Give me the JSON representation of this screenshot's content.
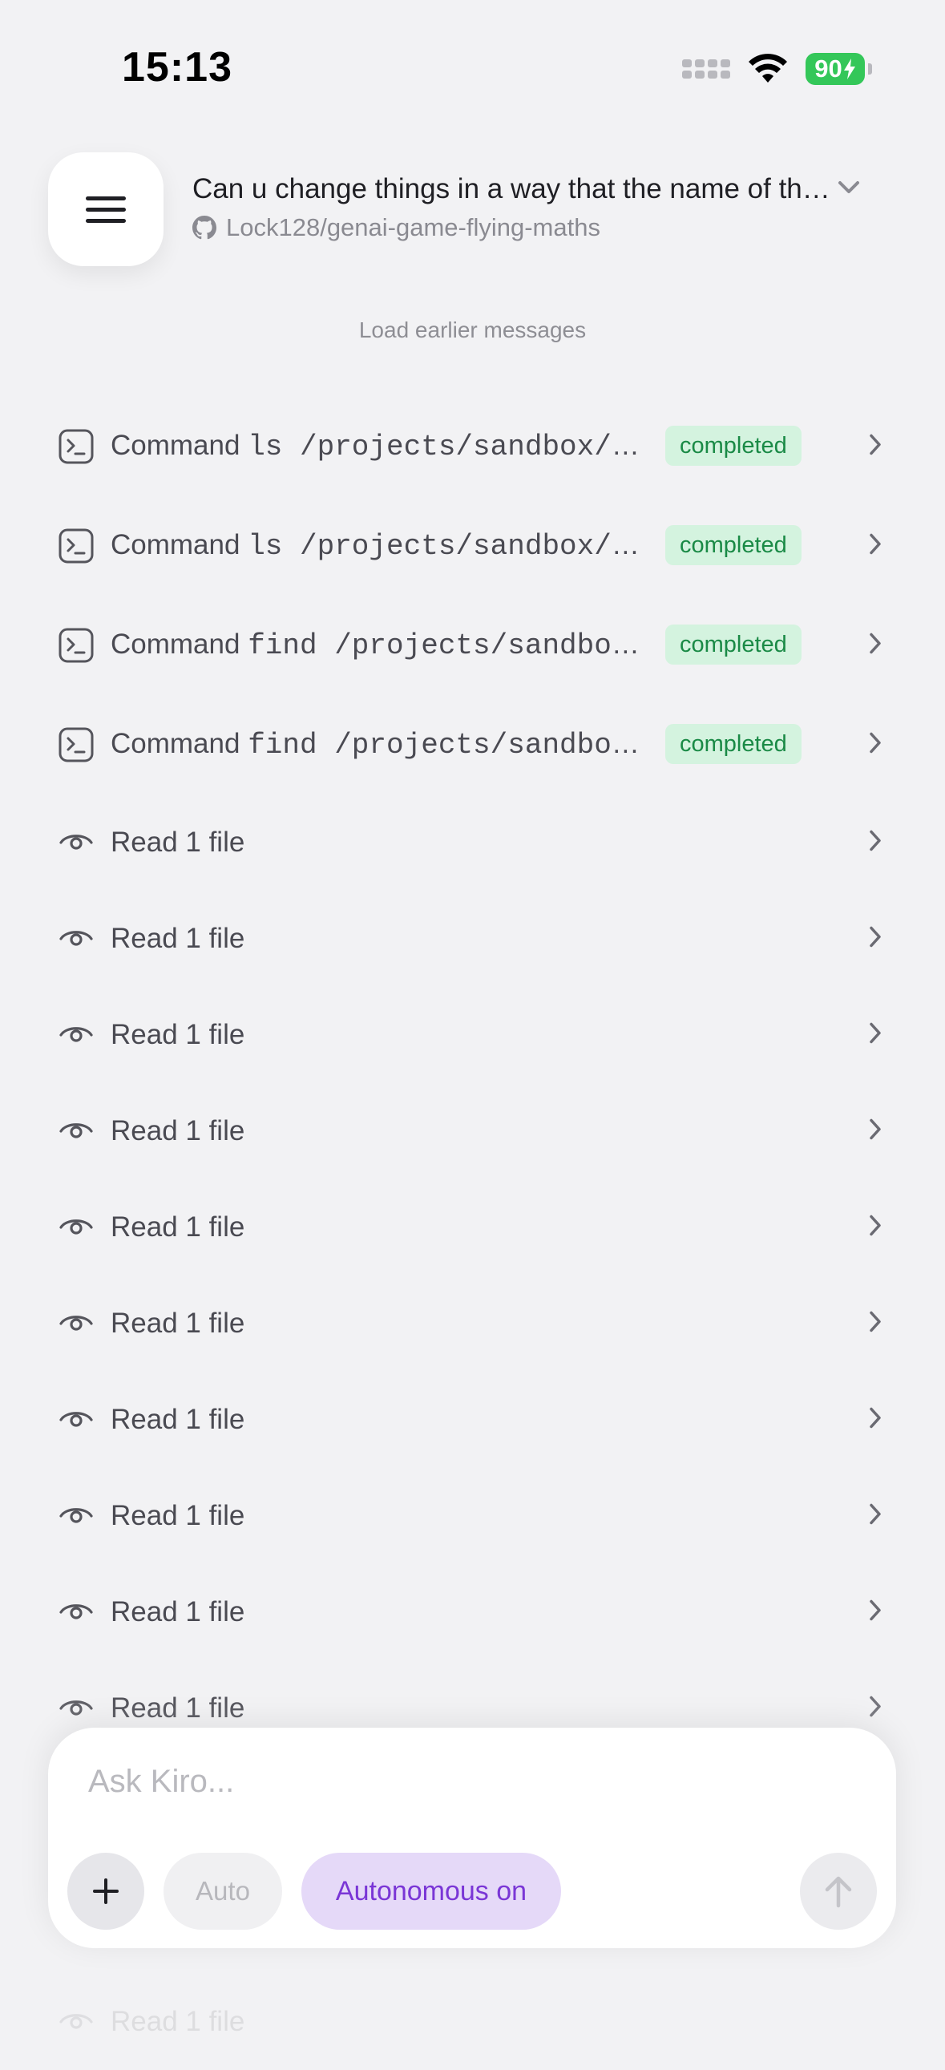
{
  "status_bar": {
    "time": "15:13",
    "battery": "90"
  },
  "header": {
    "title": "Can u change things in a way that the name of the game appears at the top",
    "repo": "Lock128/genai-game-flying-maths"
  },
  "load_earlier": "Load earlier messages",
  "commands": [
    {
      "prefix": "Command",
      "command": "ls /projects/sandbox/genai-game-flying-maths",
      "status": "completed"
    },
    {
      "prefix": "Command",
      "command": "ls /projects/sandbox/genai-game-flying-maths/lib",
      "status": "completed"
    },
    {
      "prefix": "Command",
      "command": "find /projects/sandbox/genai-game-flying-maths -name \"*.dart\"",
      "status": "completed"
    },
    {
      "prefix": "Command",
      "command": "find /projects/sandbox/genai-game-flying-maths -name \"*.yaml\"",
      "status": "completed"
    }
  ],
  "reads": [
    {
      "label": "Read 1 file"
    },
    {
      "label": "Read 1 file"
    },
    {
      "label": "Read 1 file"
    },
    {
      "label": "Read 1 file"
    },
    {
      "label": "Read 1 file"
    },
    {
      "label": "Read 1 file"
    },
    {
      "label": "Read 1 file"
    },
    {
      "label": "Read 1 file"
    },
    {
      "label": "Read 1 file"
    },
    {
      "label": "Read 1 file"
    }
  ],
  "faded_row": {
    "label": "Read 1 file"
  },
  "composer": {
    "placeholder": "Ask Kiro...",
    "model_label": "Auto",
    "autonomous_label": "Autonomous on"
  },
  "colors": {
    "background": "#f2f2f4",
    "badge_bg": "#d4f3df",
    "badge_text": "#1a8a46",
    "accent_purple": "#7a36d6",
    "battery_green": "#34c759"
  }
}
